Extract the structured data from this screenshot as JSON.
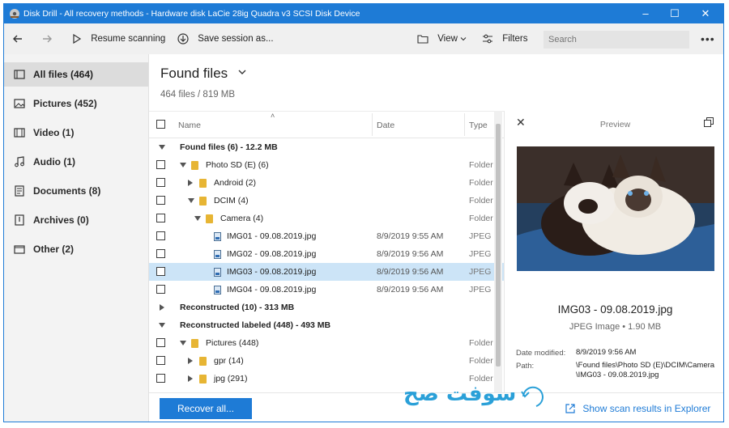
{
  "window": {
    "title": "Disk Drill - All recovery methods - Hardware disk LaCie 28ig Quadra v3 SCSI Disk Device"
  },
  "toolbar": {
    "resume_label": "Resume scanning",
    "save_label": "Save session as...",
    "view_label": "View",
    "filters_label": "Filters",
    "search_placeholder": "Search"
  },
  "sidebar": {
    "items": [
      {
        "label": "All files (464)",
        "icon": "all-files-icon",
        "active": true
      },
      {
        "label": "Pictures (452)",
        "icon": "pictures-icon"
      },
      {
        "label": "Video (1)",
        "icon": "video-icon"
      },
      {
        "label": "Audio (1)",
        "icon": "audio-icon"
      },
      {
        "label": "Documents (8)",
        "icon": "documents-icon"
      },
      {
        "label": "Archives (0)",
        "icon": "archives-icon"
      },
      {
        "label": "Other (2)",
        "icon": "other-icon"
      }
    ]
  },
  "main": {
    "title": "Found files",
    "subtitle": "464 files / 819 MB",
    "columns": {
      "name": "Name",
      "date": "Date",
      "type": "Type"
    },
    "rows": [
      {
        "kind": "group",
        "expanded": true,
        "name": "Found files (6) - 12.2 MB",
        "date": "",
        "type": ""
      },
      {
        "kind": "folder",
        "indent": 1,
        "expanded": true,
        "name": "Photo SD (E) (6)",
        "date": "",
        "type": "Folder"
      },
      {
        "kind": "folder",
        "indent": 2,
        "expanded": false,
        "name": "Android (2)",
        "date": "",
        "type": "Folder"
      },
      {
        "kind": "folder",
        "indent": 2,
        "expanded": true,
        "name": "DCIM (4)",
        "date": "",
        "type": "Folder"
      },
      {
        "kind": "folder",
        "indent": 3,
        "expanded": true,
        "name": "Camera (4)",
        "date": "",
        "type": "Folder"
      },
      {
        "kind": "file",
        "indent": 4,
        "name": "IMG01 - 09.08.2019.jpg",
        "date": "8/9/2019 9:55 AM",
        "type": "JPEG Ir"
      },
      {
        "kind": "file",
        "indent": 4,
        "name": "IMG02 - 09.08.2019.jpg",
        "date": "8/9/2019 9:56 AM",
        "type": "JPEG Ir"
      },
      {
        "kind": "file",
        "indent": 4,
        "name": "IMG03 - 09.08.2019.jpg",
        "date": "8/9/2019 9:56 AM",
        "type": "JPEG Ir",
        "selected": true
      },
      {
        "kind": "file",
        "indent": 4,
        "name": "IMG04 - 09.08.2019.jpg",
        "date": "8/9/2019 9:56 AM",
        "type": "JPEG Ir"
      },
      {
        "kind": "group",
        "expanded": false,
        "name": "Reconstructed (10) - 313 MB",
        "date": "",
        "type": ""
      },
      {
        "kind": "group",
        "expanded": true,
        "name": "Reconstructed labeled (448) - 493 MB",
        "date": "",
        "type": ""
      },
      {
        "kind": "folder",
        "indent": 1,
        "expanded": true,
        "name": "Pictures (448)",
        "date": "",
        "type": "Folder"
      },
      {
        "kind": "folder",
        "indent": 2,
        "expanded": false,
        "name": "gpr (14)",
        "date": "",
        "type": "Folder"
      },
      {
        "kind": "folder",
        "indent": 2,
        "expanded": false,
        "name": "jpg (291)",
        "date": "",
        "type": "Folder"
      }
    ]
  },
  "preview": {
    "title": "Preview",
    "file_name": "IMG03 - 09.08.2019.jpg",
    "file_meta": "JPEG Image • 1.90 MB",
    "date_label": "Date modified:",
    "date_value": "8/9/2019 9:56 AM",
    "path_label": "Path:",
    "path_line1": "\\Found files\\Photo SD (E)\\DCIM\\Camera",
    "path_line2": "\\IMG03 - 09.08.2019.jpg"
  },
  "footer": {
    "recover_label": "Recover all...",
    "show_scan_label": "Show scan results in Explorer"
  },
  "watermark": {
    "text": "سوفت صح"
  }
}
